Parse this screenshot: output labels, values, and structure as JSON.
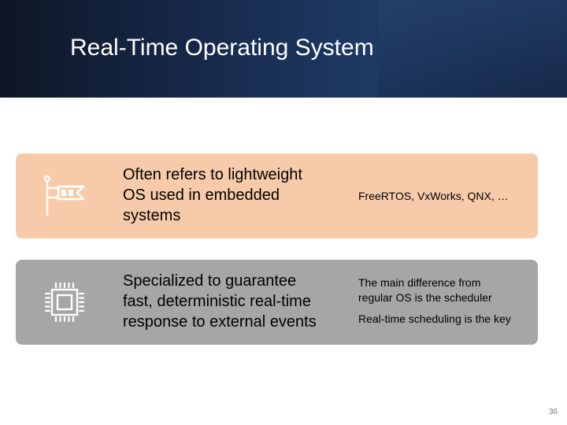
{
  "slide": {
    "title": "Real-Time Operating System",
    "page_number": "36"
  },
  "cards": [
    {
      "icon": "windsock-icon",
      "main_lines": [
        "Often refers to lightweight",
        "OS used in embedded",
        "systems"
      ],
      "side_lines": [
        "FreeRTOS, VxWorks, QNX, …"
      ],
      "color": "#f7cbaa"
    },
    {
      "icon": "processor-chip-icon",
      "main_lines": [
        "Specialized to guarantee",
        "fast, deterministic real-time",
        "response to external events"
      ],
      "side_lines": [
        "The main difference from",
        "regular OS is the scheduler",
        "Real-time scheduling is the key"
      ],
      "color": "#a6a6a6"
    }
  ],
  "colors": {
    "header_dark": "#0e1626",
    "header_blue": "#1d3a64"
  }
}
